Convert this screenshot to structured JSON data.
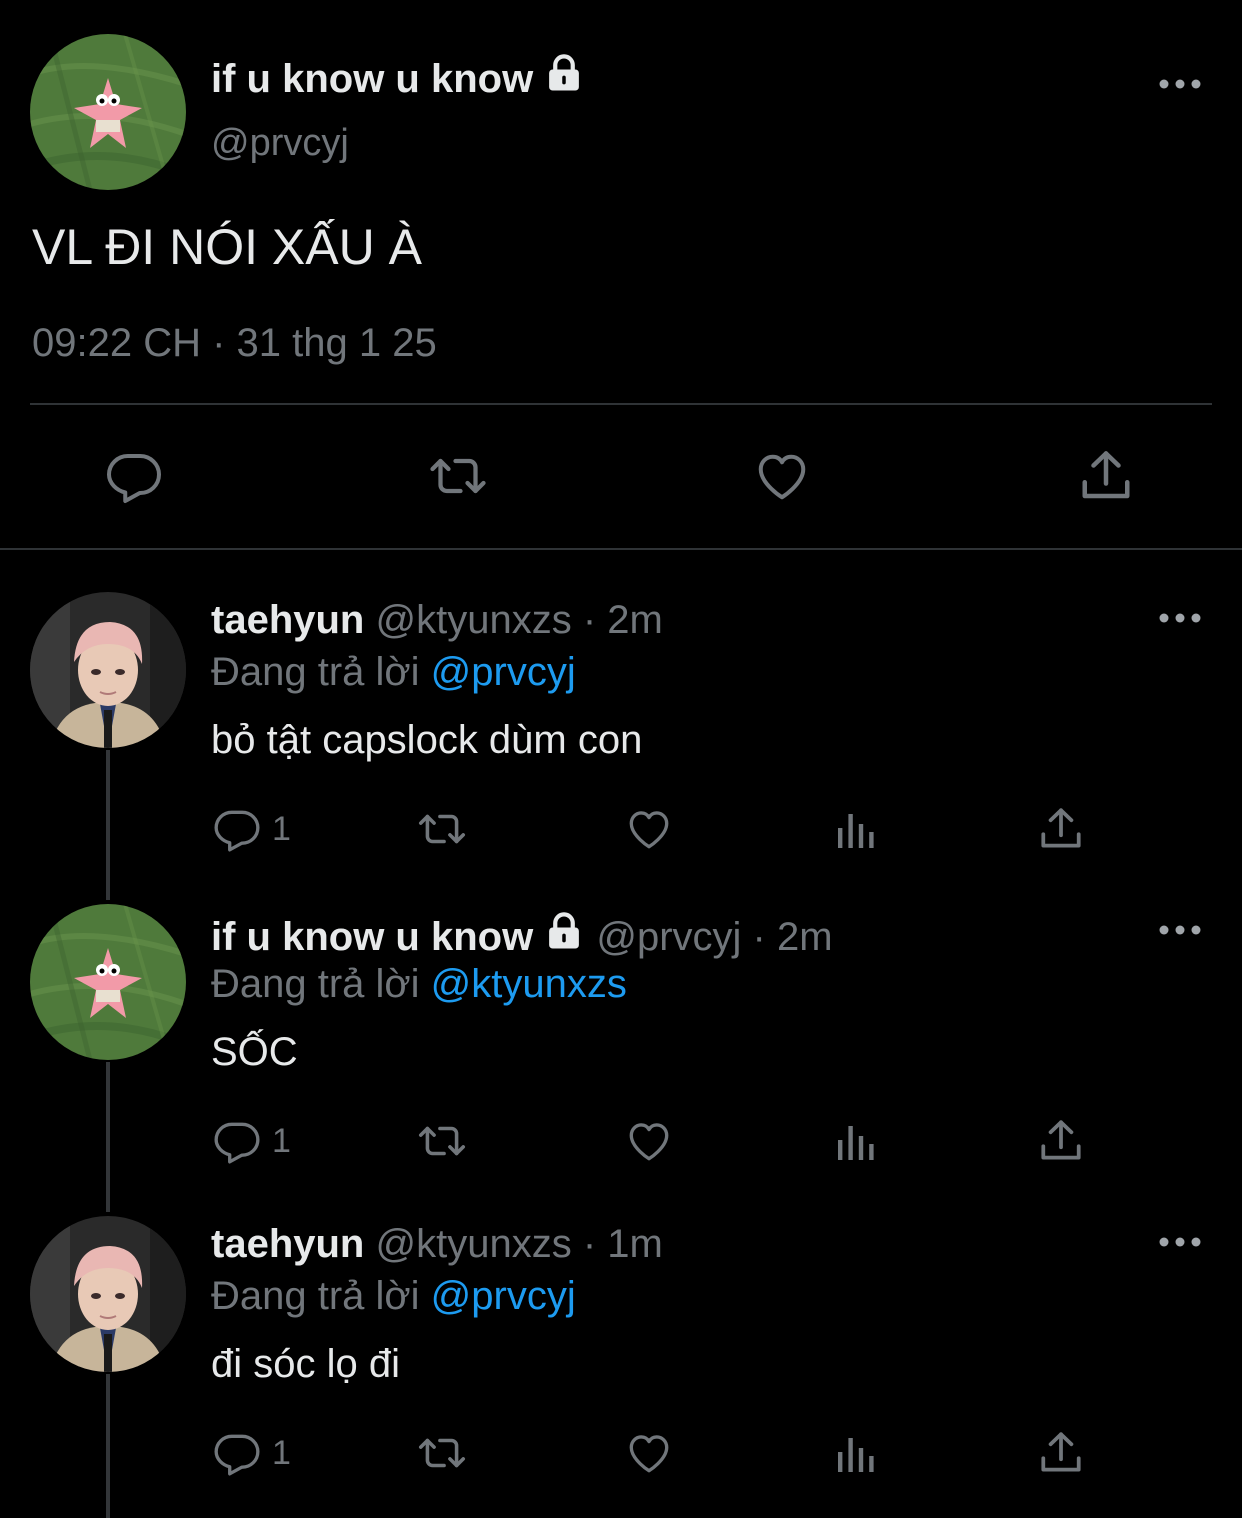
{
  "main_tweet": {
    "display_name": "if u know u know",
    "handle": "@prvcyj",
    "text": "VL ĐI NÓI XẤU À",
    "timestamp": "09:22 CH · 31 thg 1 25",
    "avatar_icon": "patrick-star-avatar",
    "protected_icon": "lock-icon"
  },
  "actions": {
    "reply_icon": "reply-icon",
    "retweet_icon": "retweet-icon",
    "like_icon": "heart-icon",
    "share_icon": "share-icon",
    "views_icon": "views-icon"
  },
  "replies": [
    {
      "display_name": "taehyun",
      "handle": "@ktyunxzs",
      "separator": "·",
      "time": "2m",
      "replying_label": "Đang trả lời",
      "replying_to": "@prvcyj",
      "text": "bỏ tật capslock dùm con",
      "reply_count": "1",
      "avatar_icon": "taehyun-avatar"
    },
    {
      "display_name": "if u know u know",
      "handle": "@prvcyj",
      "separator": "·",
      "time": "2m",
      "replying_label": "Đang trả lời",
      "replying_to": "@ktyunxzs",
      "text": "SỐC",
      "reply_count": "1",
      "avatar_icon": "patrick-star-avatar"
    },
    {
      "display_name": "taehyun",
      "handle": "@ktyunxzs",
      "separator": "·",
      "time": "1m",
      "replying_label": "Đang trả lời",
      "replying_to": "@prvcyj",
      "text": "đi sóc lọ đi",
      "reply_count": "1",
      "avatar_icon": "taehyun-avatar"
    }
  ],
  "colors": {
    "background": "#000000",
    "text": "#e7e9ea",
    "secondary": "#71767b",
    "link": "#1d9bf0",
    "divider": "#2f3336"
  }
}
